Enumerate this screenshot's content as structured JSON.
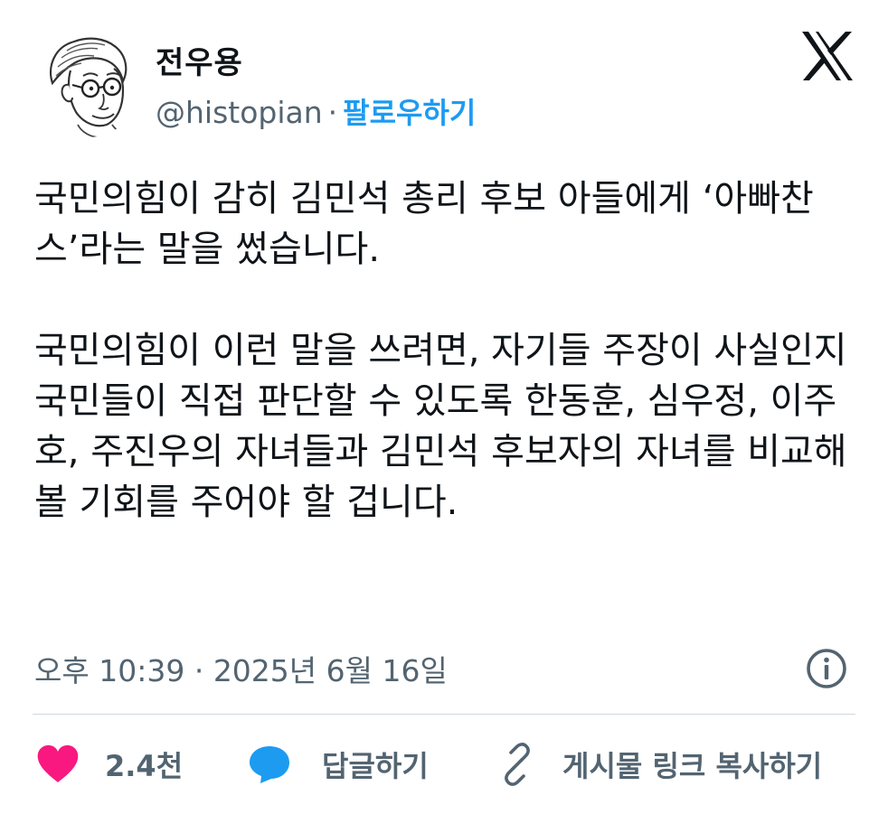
{
  "author": {
    "display_name": "전우용",
    "handle": "@histopian",
    "separator": "·",
    "follow_label": "팔로우하기",
    "avatar_icon": "caricature-avatar-icon",
    "platform_icon": "x-logo-icon"
  },
  "tweet": {
    "paragraphs": [
      "국민의힘이 감히 김민석 총리 후보 아들에게 ‘아빠찬스’라는 말을 썼습니다.",
      "국민의힘이 이런 말을 쓰려면, 자기들 주장이 사실인지 국민들이 직접 판단할 수 있도록 한동훈, 심우정, 이주호, 주진우의 자녀들과 김민석 후보자의 자녀를 비교해 볼 기회를 주어야 할 겁니다."
    ]
  },
  "meta": {
    "time": "오후 10:39",
    "separator": "·",
    "date": "2025년 6월 16일",
    "info_icon": "info-icon"
  },
  "actions": {
    "like_count": "2.4천",
    "reply_label": "답글하기",
    "copy_link_label": "게시물 링크 복사하기"
  },
  "colors": {
    "accent": "#1d9bf0",
    "like": "#f91880",
    "reply": "#1d9bf0",
    "text": "#0f1419",
    "muted": "#536471",
    "divider": "#cfd9de"
  }
}
